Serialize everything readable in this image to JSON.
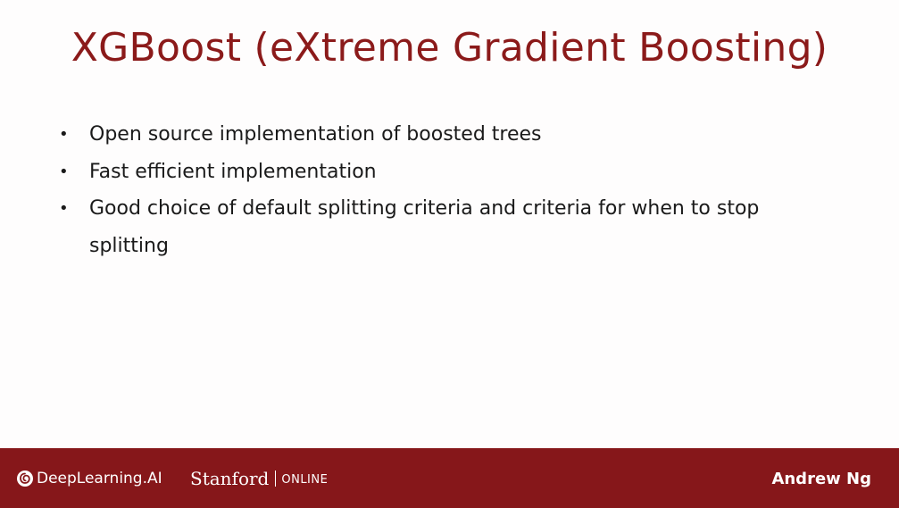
{
  "slide": {
    "title": "XGBoost (eXtreme Gradient Boosting)",
    "bullets": [
      {
        "marker": "•",
        "text": "Open source implementation of boosted trees"
      },
      {
        "marker": "•",
        "text": "Fast efficient implementation"
      },
      {
        "marker": "•",
        "text": "Good choice of default splitting criteria and criteria for when to stop splitting"
      }
    ]
  },
  "footer": {
    "deeplearning_logo_text": "DeepLearning.AI",
    "stanford_word": "Stanford",
    "stanford_online": "ONLINE",
    "presenter": "Andrew Ng"
  },
  "colors": {
    "title": "#8b1a1a",
    "footer_background": "#86171a",
    "footer_text": "#ffffff",
    "body_text": "#1a1a1a"
  }
}
